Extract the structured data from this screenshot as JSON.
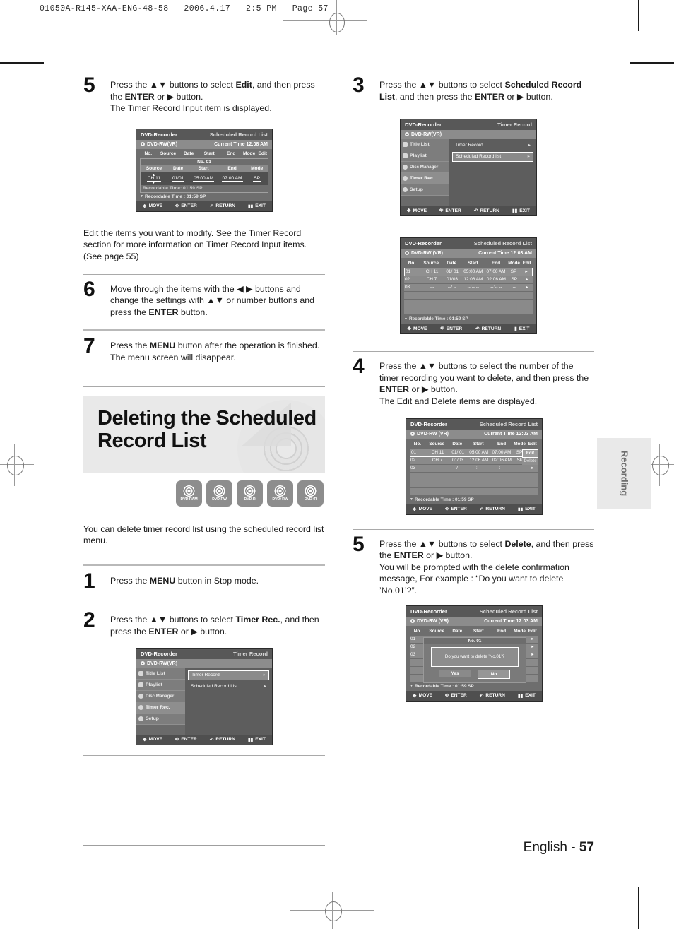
{
  "document": {
    "header_code": "01050A-R145-XAA-ENG-48-58   2006.4.17   2:5 PM   Page 57",
    "footer_language": "English - ",
    "footer_page": "57",
    "side_tab": "Recording"
  },
  "left_column": {
    "step5": {
      "number": "5",
      "line1_a": "Press the ",
      "line1_arrows": "▲▼",
      "line1_b": " buttons to select ",
      "line1_bold": "Edit",
      "line1_c": ", and then press the ",
      "line1_bold2": "ENTER",
      "line1_d": " or ▶ button.",
      "line2": "The Timer Record Input item is displayed."
    },
    "note": "Edit the items you want to modify. See the Timer Record section for more information on Timer Record Input items. (See page 55)",
    "step6": {
      "number": "6",
      "text_a": "Move through the items with the ◀ ▶ buttons and change the settings with ▲▼ or number buttons and press the ",
      "bold": "ENTER",
      "text_b": " button."
    },
    "step7": {
      "number": "7",
      "text_a": "Press the ",
      "bold": "MENU",
      "text_b": " button after the operation is finished.",
      "line2": "The menu screen will disappear."
    },
    "section_title": "Deleting the Scheduled Record List",
    "badges": [
      "DVD-RAM",
      "DVD-RW",
      "DVD-R",
      "DVD+RW",
      "DVD+R"
    ],
    "intro": "You can delete timer record list using the scheduled record list menu.",
    "step1": {
      "number": "1",
      "text_a": "Press the ",
      "bold": "MENU",
      "text_b": " button in Stop mode."
    },
    "step2": {
      "number": "2",
      "text_a": "Press the ▲▼ buttons to select ",
      "bold": "Timer Rec.",
      "text_b": ", and then press the ",
      "bold2": "ENTER",
      "text_c": " or ▶ button."
    }
  },
  "right_column": {
    "step3": {
      "number": "3",
      "text_a": "Press the ▲▼ buttons to select ",
      "bold": "Scheduled Record List",
      "text_b": ", and then press the ",
      "bold2": "ENTER",
      "text_c": " or ▶ button."
    },
    "step4": {
      "number": "4",
      "text_a": "Press the ▲▼ buttons to select the number of the timer recording you want to delete, and then press the ",
      "bold": "ENTER",
      "text_b": " or ▶ button.",
      "line2": "The Edit and Delete items are displayed."
    },
    "step5": {
      "number": "5",
      "text_a": "Press the ▲▼ buttons to select ",
      "bold": "Delete",
      "text_b": ", and then press the ",
      "bold2": "ENTER",
      "text_c": " or ▶ button.",
      "line2": "You will be prompted with the delete confirmation message, For example : “Do you want to delete ’No.01’?”."
    }
  },
  "osd_common": {
    "brand": "DVD-Recorder",
    "disc_label": "DVD-RW(VR)",
    "disc_label_spaced": "DVD-RW (VR)",
    "footer": [
      {
        "icon": "dpad-icon",
        "label": "MOVE"
      },
      {
        "icon": "enter-icon",
        "label": "ENTER"
      },
      {
        "icon": "return-icon",
        "label": "RETURN"
      },
      {
        "icon": "exit-icon",
        "label": "EXIT"
      }
    ]
  },
  "osd_edit_input": {
    "screen_title": "Scheduled Record List",
    "current_time_label": "Current Time",
    "current_time": "12:08 AM",
    "columns": [
      "No.",
      "Source",
      "Date",
      "Start",
      "End",
      "Mode",
      "Edit"
    ],
    "panel_title": "No. 01",
    "panel_columns": [
      "Source",
      "Date",
      "Start",
      "End",
      "Mode"
    ],
    "panel_values": [
      "CH 11",
      "01/01",
      "05:00 AM",
      "07:00 AM",
      "SP"
    ],
    "panel_rec_time": "Recordable Time: 01:59 SP",
    "rec_time": "Recordable Time : 01:59  SP"
  },
  "osd_timer_menu_right": {
    "screen_title": "Timer Record",
    "sidebar": [
      "Title List",
      "Playlist",
      "Disc Manager",
      "Timer Rec.",
      "Setup"
    ],
    "sidebar_active_index": 3,
    "panel_items": [
      "Timer Record",
      "Scheduled Record list"
    ],
    "panel_selected_index": 1
  },
  "osd_timer_menu_left": {
    "screen_title": "Timer Record",
    "sidebar": [
      "Title List",
      "Playlist",
      "Disc Manager",
      "Timer Rec.",
      "Setup"
    ],
    "sidebar_active_index": 3,
    "panel_items": [
      "Timer Record",
      "Scheduled Record List"
    ],
    "panel_selected_index": 0
  },
  "osd_list": {
    "screen_title": "Scheduled Record List",
    "current_time_label": "Current Time",
    "current_time": "12:03 AM",
    "columns": [
      "No.",
      "Source",
      "Date",
      "Start",
      "End",
      "Mode",
      "Edit"
    ],
    "rows": [
      {
        "no": "01",
        "source": "CH 11",
        "date": "01/ 01",
        "start": "05:00 AM",
        "end": "07:00 AM",
        "mode": "SP",
        "edit": "▸"
      },
      {
        "no": "02",
        "source": "CH 7",
        "date": "01/03",
        "start": "12:06 AM",
        "end": "02:06 AM",
        "mode": "SP",
        "edit": "▸"
      },
      {
        "no": "03",
        "source": "---",
        "date": "--/ --",
        "start": "--:-- --",
        "end": "--:-- --",
        "mode": "--",
        "edit": "▸"
      }
    ],
    "empty_rows": 3,
    "rec_time": "Recordable Time :  01:59  SP"
  },
  "osd_list_editmenu": {
    "screen_title": "Scheduled Record List",
    "current_time_label": "Current Time",
    "current_time": "12:03 AM",
    "popup_items": [
      "Edit",
      "Delete"
    ],
    "popup_selected_index": 0
  },
  "osd_confirm": {
    "screen_title": "Scheduled Record List",
    "current_time_label": "Current Time",
    "current_time": "12:03 AM",
    "dialog_title": "No. 01",
    "dialog_message": "Do you want to delete ’No.01’?",
    "yes_label": "Yes",
    "no_label": "No",
    "selected_button": "No"
  }
}
